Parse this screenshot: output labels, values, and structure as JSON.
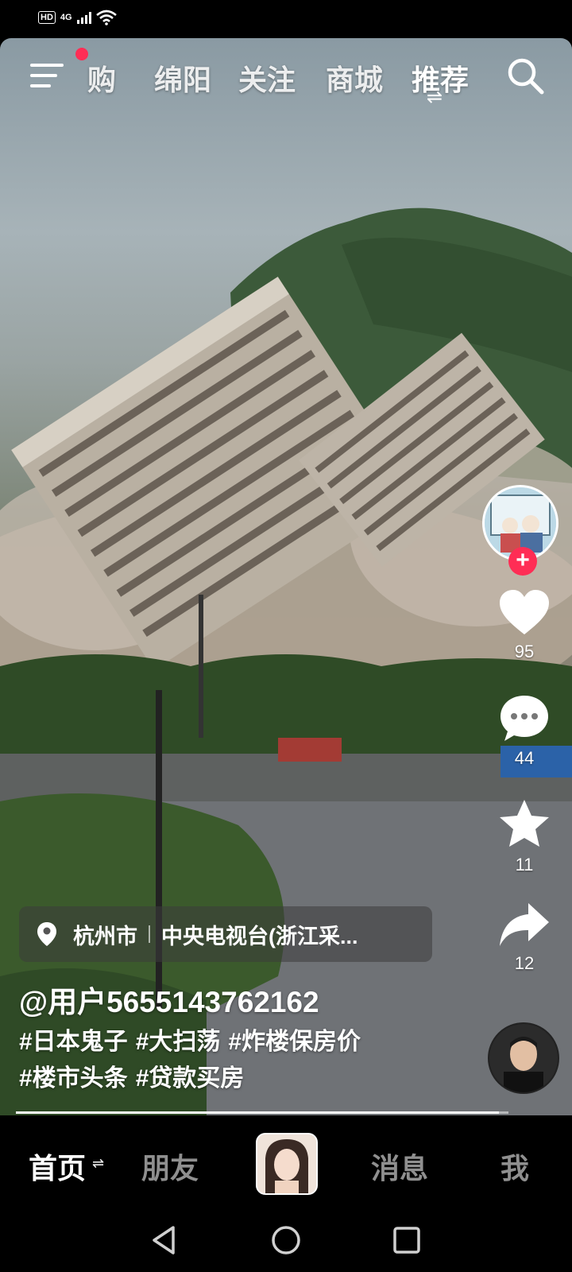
{
  "status_bar": {
    "hd": "HD",
    "network": "4G"
  },
  "top_nav": {
    "tabs": [
      "购",
      "绵阳",
      "关注",
      "商城",
      "推荐"
    ],
    "active_tab": "推荐"
  },
  "side": {
    "like_count": "95",
    "comment_count": "44",
    "favorite_count": "11",
    "share_count": "12"
  },
  "location": {
    "city": "杭州市",
    "source": "中央电视台(浙江采..."
  },
  "author": {
    "handle": "@用户5655143762162"
  },
  "caption": {
    "tags": [
      "#日本鬼子",
      "#大扫荡",
      "#炸楼保房价",
      "#楼市头条",
      "#贷款买房"
    ]
  },
  "progress": {
    "fraction": 0.98
  },
  "bottom_nav": {
    "home": "首页",
    "friends": "朋友",
    "messages": "消息",
    "me": "我"
  },
  "colors": {
    "accent": "#ff2d55",
    "background": "#000000"
  },
  "icons": [
    "menu-icon",
    "search-icon",
    "heart-icon",
    "comment-icon",
    "star-icon",
    "share-icon",
    "location-pin-icon",
    "back-icon",
    "home-circle-icon",
    "recents-icon"
  ]
}
